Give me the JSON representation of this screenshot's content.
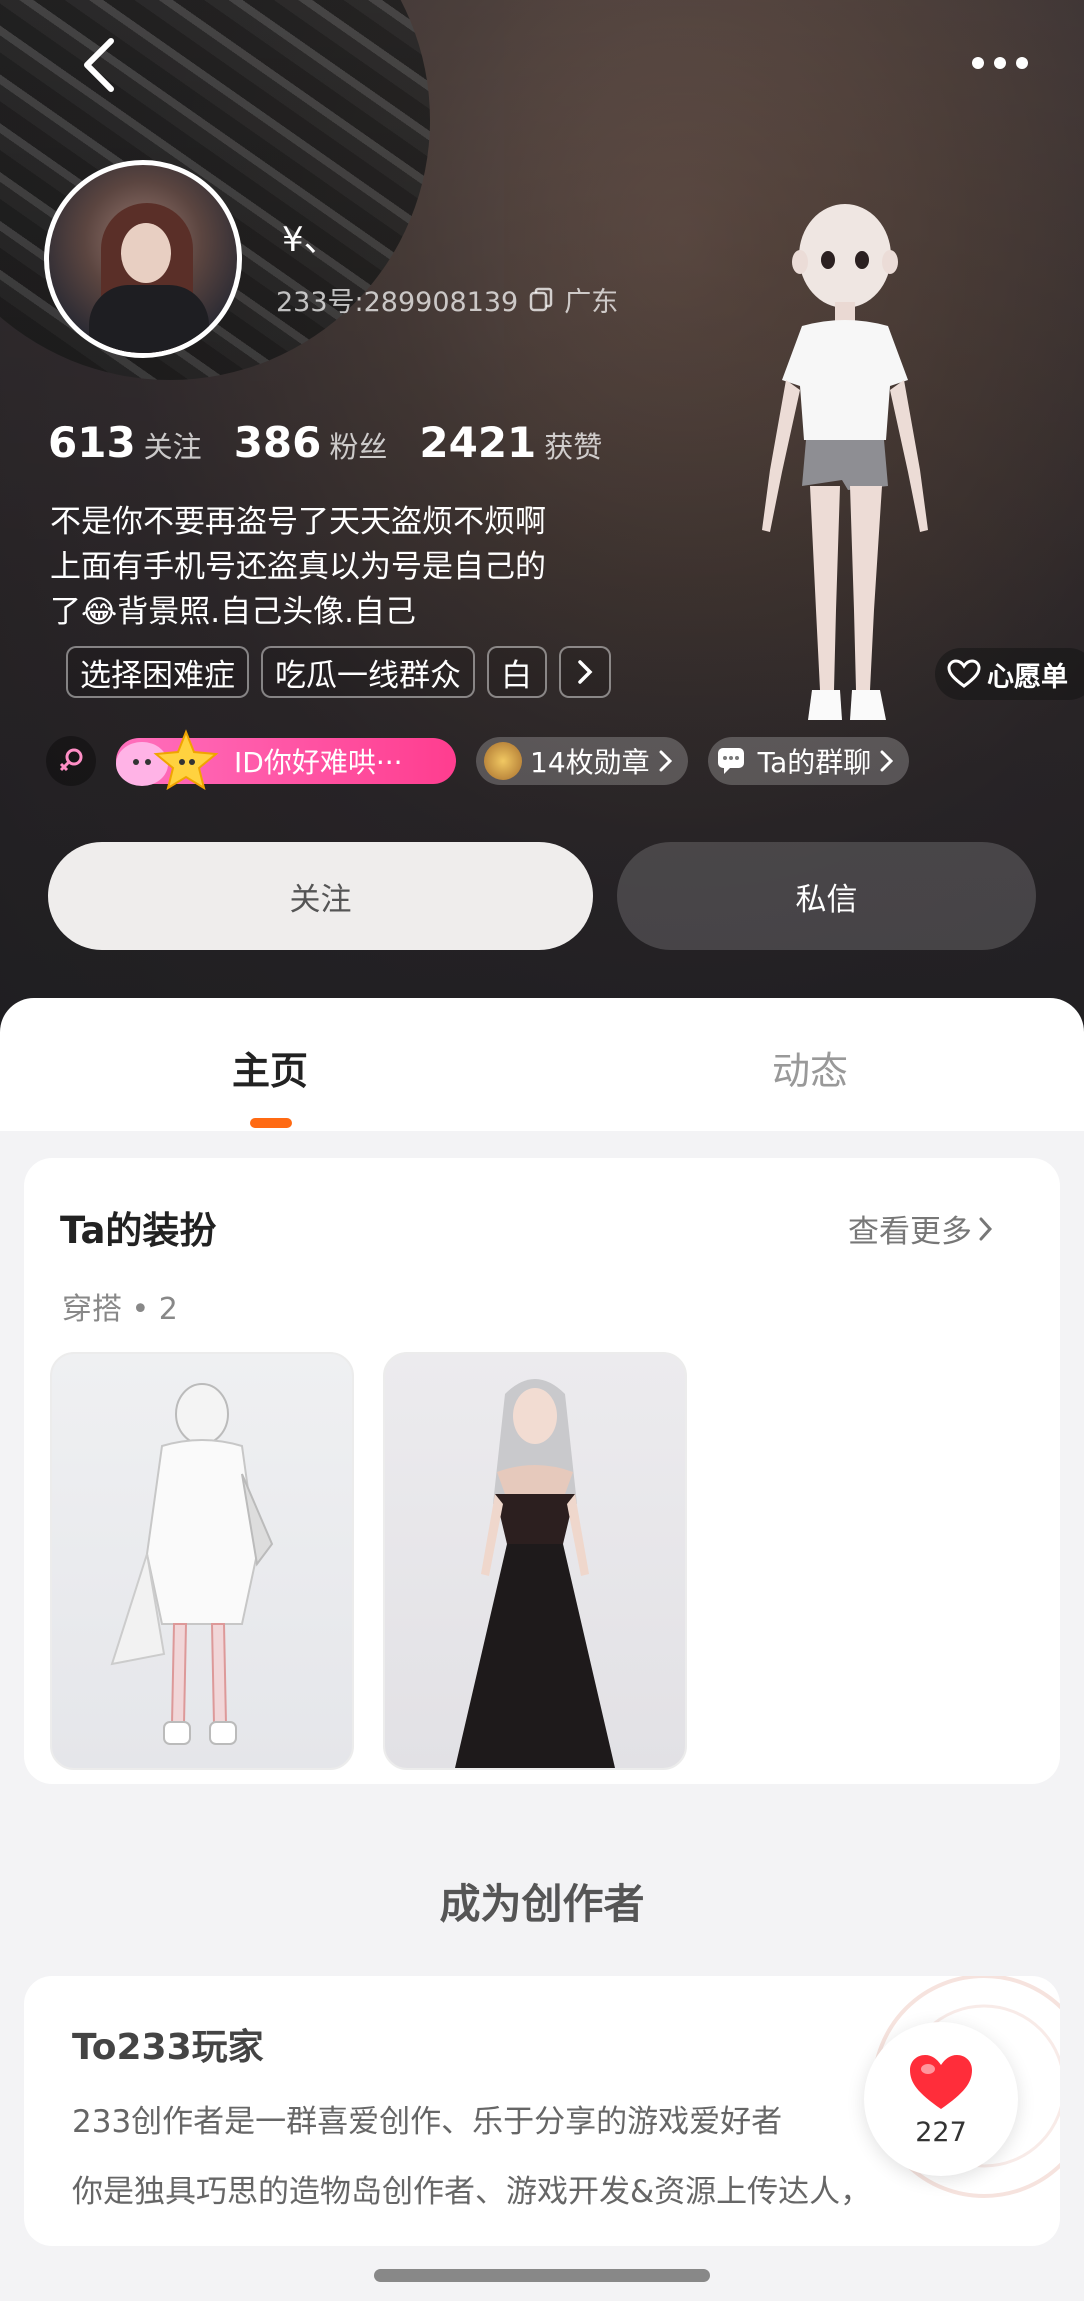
{
  "profile": {
    "nickname": "¥、",
    "uid": "233号:289908139",
    "location": "广东",
    "stats": [
      {
        "value": "613",
        "label": "关注"
      },
      {
        "value": "386",
        "label": "粉丝"
      },
      {
        "value": "2421",
        "label": "获赞"
      }
    ],
    "bio_lines": [
      "不是你不要再盗号了天天盗烦不烦啊",
      "上面有手机号还盗真以为号是自己的",
      "了😂背景照.自己头像.自己"
    ],
    "tags": [
      "选择困难症",
      "吃瓜一线群众",
      "白"
    ],
    "wishlist_label": "心愿单",
    "id_badge": "ID你好难哄···",
    "medals_label": "14枚勋章",
    "group_chat_label": "Ta的群聊"
  },
  "actions": {
    "follow_label": "关注",
    "message_label": "私信"
  },
  "tabs": [
    {
      "label": "主页",
      "active": true
    },
    {
      "label": "动态",
      "active": false
    }
  ],
  "outfits": {
    "title": "Ta的装扮",
    "more_label": "查看更多",
    "subtitle": "穿搭 • 2",
    "count": 2
  },
  "creator": {
    "section_title": "成为创作者",
    "heading": "To233玩家",
    "line1": "233创作者是一群喜爱创作、乐于分享的游戏爱好者",
    "line2": "你是独具巧思的造物岛创作者、游戏开发&资源上传达人，"
  },
  "like": {
    "count": "227"
  },
  "colors": {
    "accent": "#ff6a13",
    "pink_pill": "#ff3d8f",
    "heart": "#ff2d3a"
  }
}
